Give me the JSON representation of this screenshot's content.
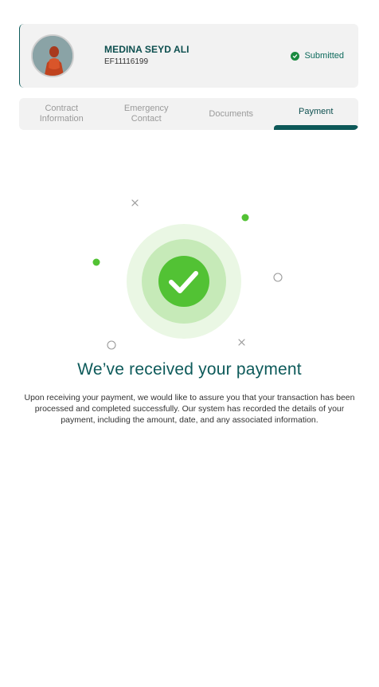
{
  "profile": {
    "name": "MEDINA SEYD ALI",
    "employee_id": "EF11116199",
    "status": "Submitted"
  },
  "tabs": [
    {
      "label": "Contract Information",
      "active": false
    },
    {
      "label": "Emergency Contact",
      "active": false
    },
    {
      "label": "Documents",
      "active": false
    },
    {
      "label": "Payment",
      "active": true
    }
  ],
  "confirmation": {
    "title": "We’ve received your payment",
    "message": "Upon receiving your payment, we would like to assure you that your transaction has been processed and completed successfully. Our system has recorded the details of your payment, including the amount, date, and any associated information."
  },
  "colors": {
    "brand": "#0d5a5a",
    "success": "#52c234",
    "status_green": "#1a8a3f"
  },
  "icons": {
    "status": "check-circle-icon",
    "success": "check-icon"
  }
}
